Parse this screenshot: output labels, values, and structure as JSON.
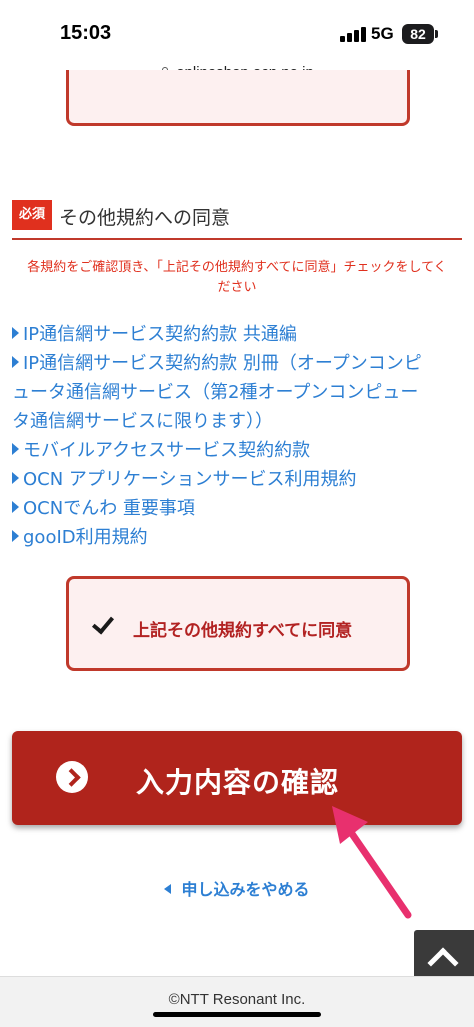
{
  "status_bar": {
    "time": "15:03",
    "network": "5G",
    "battery": "82"
  },
  "browser": {
    "url": "onlineshop.ocn.ne.jp"
  },
  "section": {
    "required_badge": "必須",
    "title": "その他規約への同意",
    "notice_line1": "各規約をご確認頂き、「上記その他規約すべてに同意」チェックをしてく",
    "notice_line2": "ださい"
  },
  "links": [
    "IP通信網サービス契約約款 共通編",
    "IP通信網サービス契約約款 別冊（オープンコンピ",
    "ュータ通信網サービス（第2種オープンコンピュー",
    "タ通信網サービスに限ります））",
    "モバイルアクセスサービス契約約款",
    "OCN アプリケーションサービス利用規約",
    "OCNでんわ 重要事項",
    "gooID利用規約"
  ],
  "agreement": {
    "label": "上記その他規約すべてに同意",
    "checked": true
  },
  "confirm_button": {
    "label": "入力内容の確認"
  },
  "cancel_link": {
    "label": "申し込みをやめる"
  },
  "footer": {
    "copyright": "©NTT Resonant Inc."
  },
  "colors": {
    "brand_red": "#b0241c",
    "required_red": "#e0301e",
    "link_blue": "#2d7fd3",
    "annotation_pink": "#e8306e"
  }
}
